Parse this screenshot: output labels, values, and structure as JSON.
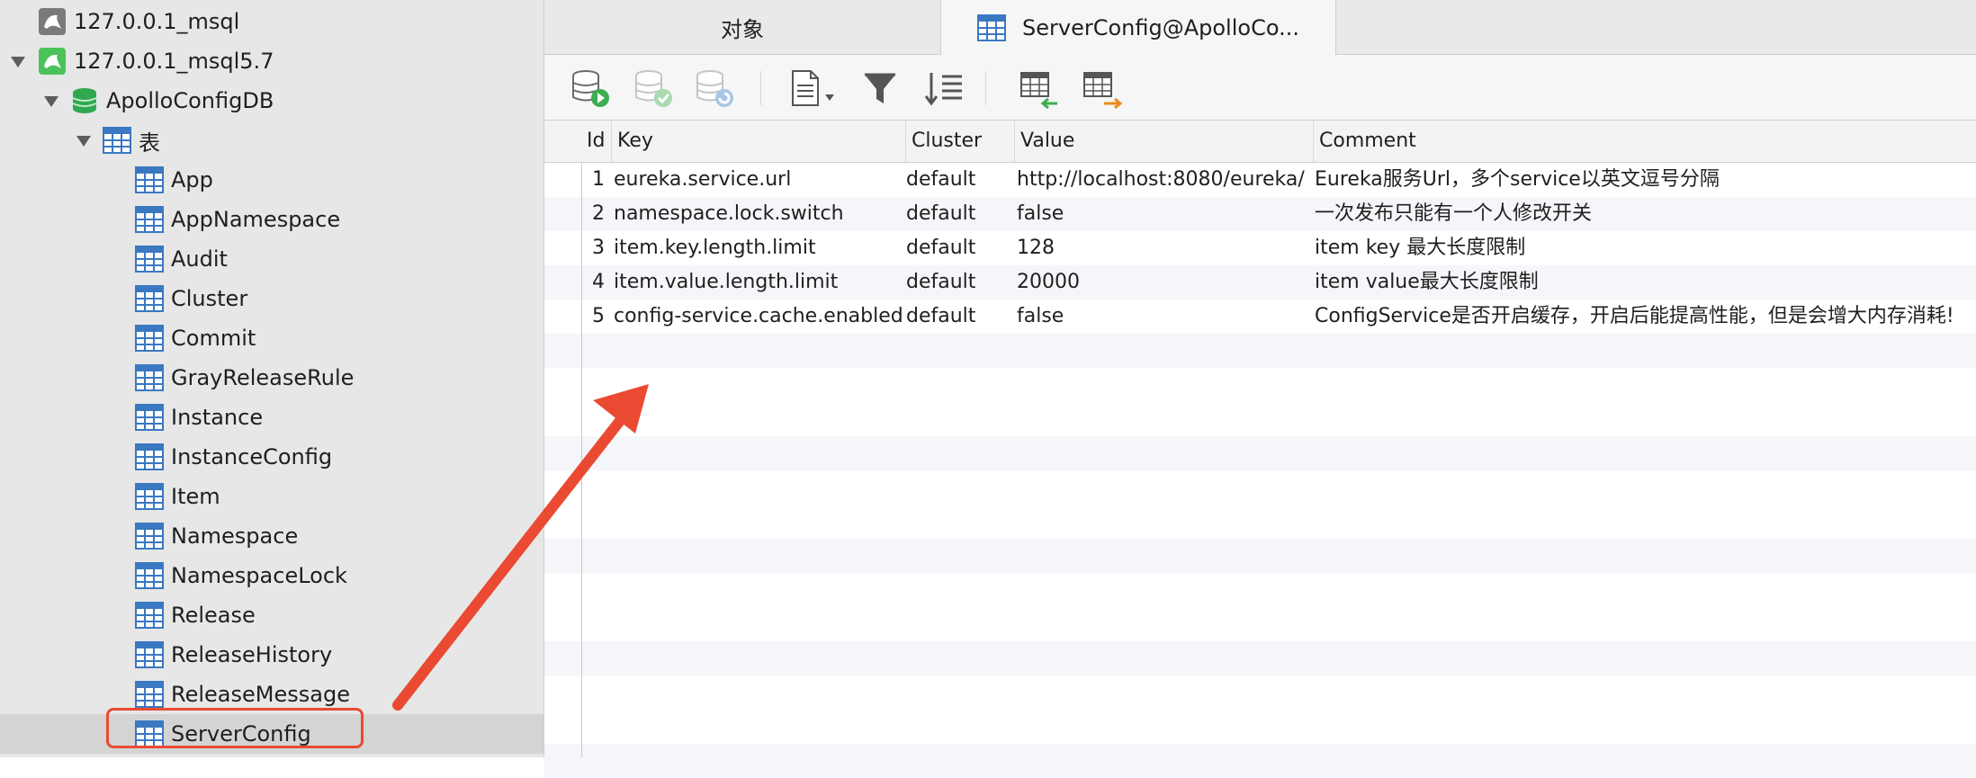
{
  "sidebar": {
    "connections": [
      {
        "label": "127.0.0.1_msql"
      },
      {
        "label": "127.0.0.1_msql5.7"
      }
    ],
    "database": {
      "label": "ApolloConfigDB"
    },
    "tables_folder": {
      "label": "表"
    },
    "tables": [
      {
        "label": "App"
      },
      {
        "label": "AppNamespace"
      },
      {
        "label": "Audit"
      },
      {
        "label": "Cluster"
      },
      {
        "label": "Commit"
      },
      {
        "label": "GrayReleaseRule"
      },
      {
        "label": "Instance"
      },
      {
        "label": "InstanceConfig"
      },
      {
        "label": "Item"
      },
      {
        "label": "Namespace"
      },
      {
        "label": "NamespaceLock"
      },
      {
        "label": "Release"
      },
      {
        "label": "ReleaseHistory"
      },
      {
        "label": "ReleaseMessage"
      },
      {
        "label": "ServerConfig"
      }
    ],
    "selected_table": "ServerConfig"
  },
  "tabs": [
    {
      "label": "对象",
      "active": false
    },
    {
      "label": "ServerConfig@ApolloCo...",
      "active": true
    }
  ],
  "toolbar": {
    "buttons": [
      "run-query-icon",
      "apply-changes-icon",
      "discard-changes-icon",
      "document-icon",
      "filter-icon",
      "sort-icon",
      "import-icon",
      "export-icon"
    ]
  },
  "grid": {
    "columns": [
      "Id",
      "Key",
      "Cluster",
      "Value",
      "Comment"
    ],
    "rows": [
      {
        "id": "1",
        "key": "eureka.service.url",
        "cluster": "default",
        "value": "http://localhost:8080/eureka/",
        "comment": "Eureka服务Url，多个service以英文逗号分隔"
      },
      {
        "id": "2",
        "key": "namespace.lock.switch",
        "cluster": "default",
        "value": "false",
        "comment": "一次发布只能有一个人修改开关"
      },
      {
        "id": "3",
        "key": "item.key.length.limit",
        "cluster": "default",
        "value": "128",
        "comment": "item key 最大长度限制"
      },
      {
        "id": "4",
        "key": "item.value.length.limit",
        "cluster": "default",
        "value": "20000",
        "comment": "item value最大长度限制"
      },
      {
        "id": "5",
        "key": "config-service.cache.enabled",
        "cluster": "default",
        "value": "false",
        "comment": "ConfigService是否开启缓存，开启后能提高性能，但是会增大内存消耗!"
      }
    ]
  },
  "colors": {
    "annotation": "#ea4a32",
    "mysql_icon_inactive": "#7a7a7a",
    "mysql_icon_active": "#4cc35a",
    "database_icon": "#2fa84f",
    "table_icon": "#3a78c2"
  }
}
